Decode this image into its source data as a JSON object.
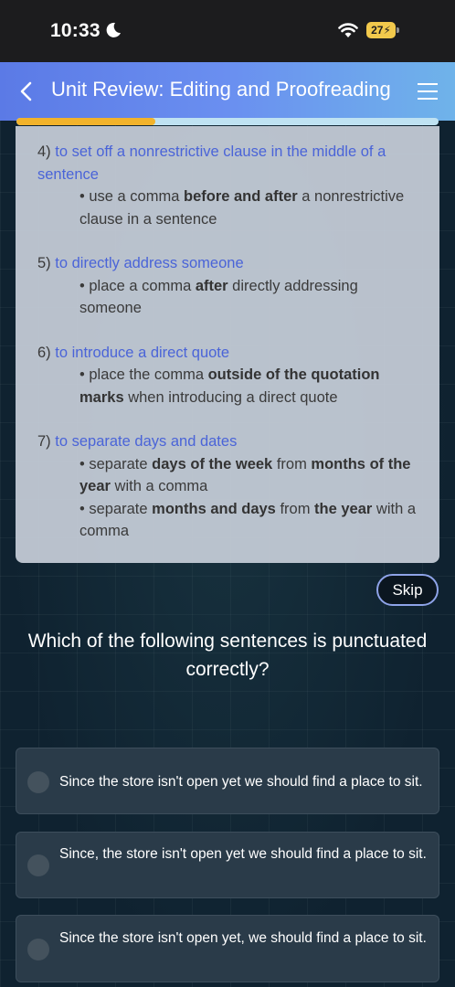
{
  "status": {
    "time": "10:33",
    "battery": "27"
  },
  "header": {
    "title": "Unit Review: Editing and Proofreading"
  },
  "progress": {
    "fraction": 0.33
  },
  "rules": [
    {
      "number": "4)",
      "title": "to set off a nonrestrictive clause in the middle of a sentence",
      "bullets": [
        [
          {
            "t": "• use a comma ",
            "b": false
          },
          {
            "t": "before and after",
            "b": true
          },
          {
            "t": " a nonrestrictive clause in a sentence",
            "b": false
          }
        ]
      ]
    },
    {
      "number": "5)",
      "title": "to directly address someone",
      "bullets": [
        [
          {
            "t": "• place a comma ",
            "b": false
          },
          {
            "t": "after",
            "b": true
          },
          {
            "t": " directly addressing someone",
            "b": false
          }
        ]
      ]
    },
    {
      "number": "6)",
      "title": "to introduce a direct quote",
      "bullets": [
        [
          {
            "t": "• place the comma ",
            "b": false
          },
          {
            "t": "outside of the quotation marks",
            "b": true
          },
          {
            "t": " when introducing a direct quote",
            "b": false
          }
        ]
      ]
    },
    {
      "number": "7)",
      "title": "to separate days and dates",
      "bullets": [
        [
          {
            "t": "• separate ",
            "b": false
          },
          {
            "t": "days of the week",
            "b": true
          },
          {
            "t": " from ",
            "b": false
          },
          {
            "t": "months of the year",
            "b": true
          },
          {
            "t": " with a comma",
            "b": false
          }
        ],
        [
          {
            "t": "• separate ",
            "b": false
          },
          {
            "t": "months and days",
            "b": true
          },
          {
            "t": " from ",
            "b": false
          },
          {
            "t": "the year",
            "b": true
          },
          {
            "t": " with a comma",
            "b": false
          }
        ]
      ]
    }
  ],
  "skip_label": "Skip",
  "question": "Which of the following sentences is punctuated correctly?",
  "options": [
    {
      "text": "Since the store isn't open yet we should find a place to sit."
    },
    {
      "text": "Since, the store isn't open yet we should find a place to sit."
    },
    {
      "text": "Since the store isn't open yet, we should find a place to sit."
    }
  ]
}
